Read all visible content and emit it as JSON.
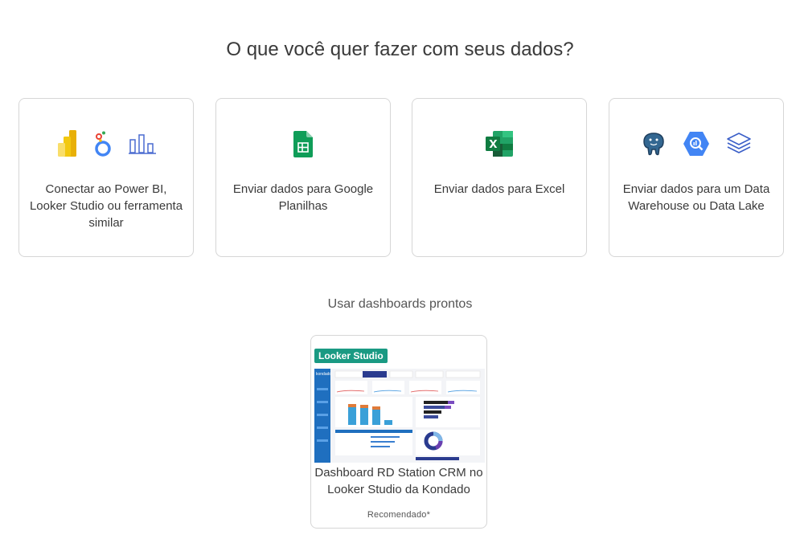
{
  "page": {
    "title": "O que você quer fazer com seus dados?"
  },
  "options": [
    {
      "label": "Conectar ao Power BI, Looker Studio ou ferramenta similar",
      "icons": [
        "power-bi-icon",
        "looker-studio-icon",
        "bar-chart-icon"
      ]
    },
    {
      "label": "Enviar dados para Google Planilhas",
      "icons": [
        "google-sheets-icon"
      ]
    },
    {
      "label": "Enviar dados para Excel",
      "icons": [
        "excel-icon"
      ]
    },
    {
      "label": "Enviar dados para um Data Warehouse ou Data Lake",
      "icons": [
        "postgresql-icon",
        "bigquery-icon",
        "layers-icon"
      ]
    }
  ],
  "dashboards": {
    "heading": "Usar dashboards prontos",
    "items": [
      {
        "badge": "Looker Studio",
        "title": "Dashboard RD Station CRM no Looker Studio da Kondado",
        "note": "Recomendado*",
        "preview_brand": "kondado"
      }
    ]
  },
  "colors": {
    "card_border": "#d6d6d6",
    "looker_badge": "#1a9a83",
    "power_bi": "#f2c811",
    "sheets": "#0f9d58",
    "excel": "#107c41",
    "bigquery": "#4285f4",
    "postgres": "#336791"
  }
}
